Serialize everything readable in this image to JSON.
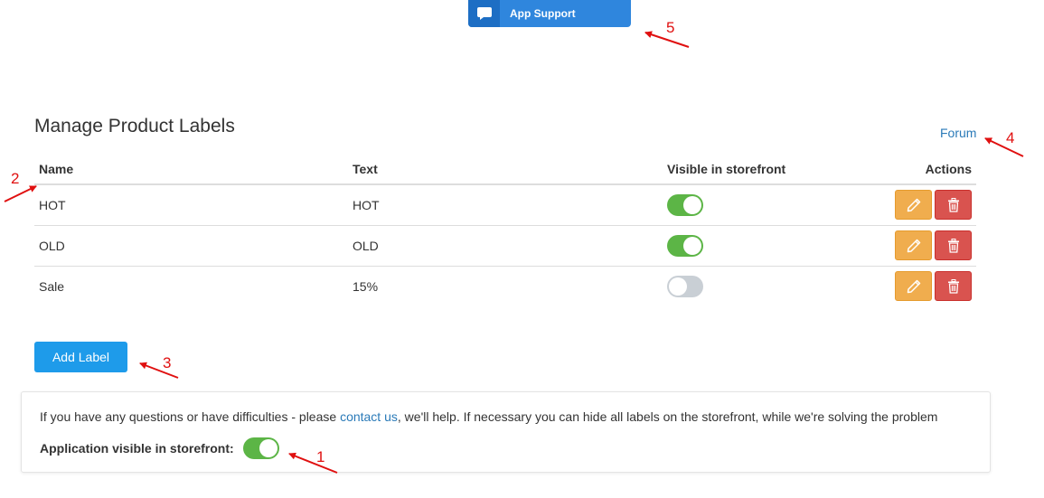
{
  "support": {
    "label": "App Support",
    "icon": "chat-bubble-icon"
  },
  "page": {
    "title": "Manage Product Labels",
    "forum_link": "Forum"
  },
  "table": {
    "headers": {
      "name": "Name",
      "text": "Text",
      "visible": "Visible in storefront",
      "actions": "Actions"
    },
    "rows": [
      {
        "name": "HOT",
        "text": "HOT",
        "visible": true
      },
      {
        "name": "OLD",
        "text": "OLD",
        "visible": true
      },
      {
        "name": "Sale",
        "text": "15%",
        "visible": false
      }
    ]
  },
  "add_label_button": "Add Label",
  "info": {
    "text_before": "If you have any questions or have difficulties - please ",
    "contact_link": "contact us",
    "text_after": ", we'll help. If necessary you can hide all labels on the storefront, while we're solving the problem",
    "app_visible_label": "Application visible in storefront:",
    "app_visible": true
  },
  "annotations": [
    "1",
    "2",
    "3",
    "4",
    "5"
  ],
  "colors": {
    "primary": "#1e9bea",
    "support": "#2f86dd",
    "toggle_on": "#5cb546",
    "toggle_off": "#c9cfd5",
    "edit": "#f0ad4e",
    "delete": "#d9534f",
    "link": "#2a7ab8",
    "annotation": "#e01010"
  }
}
